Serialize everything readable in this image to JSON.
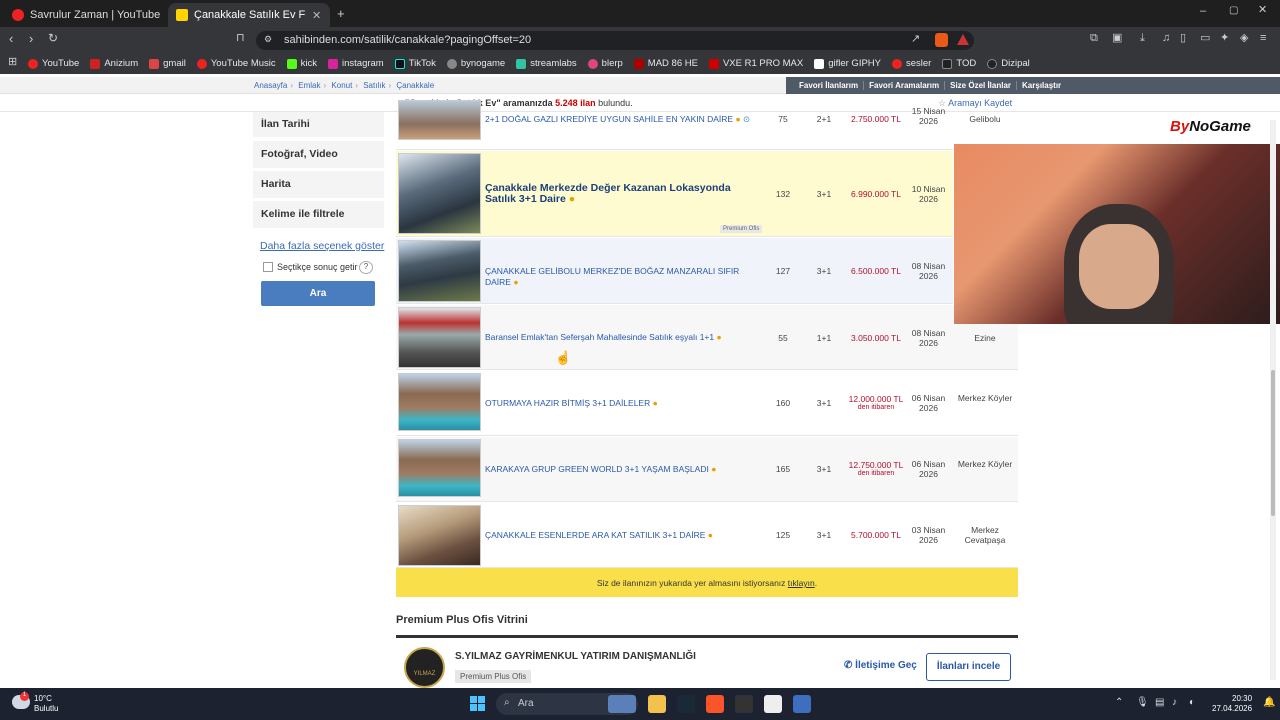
{
  "browser": {
    "tabs": [
      {
        "title": "Savrulur Zaman | YouTube Music"
      },
      {
        "title": "Çanakkale Satılık Ev Fiyatları sahi"
      }
    ],
    "url": "sahibinden.com/satilik/canakkale?pagingOffset=20",
    "bookmarks": [
      "YouTube",
      "Anizium",
      "gmail",
      "YouTube Music",
      "kick",
      "instagram",
      "TikTok",
      "bynogame",
      "streamlabs",
      "blerp",
      "MAD 86 HE",
      "VXE R1 PRO MAX",
      "gifler GIPHY",
      "sesler",
      "TOD",
      "Dizipal"
    ]
  },
  "site": {
    "breadcrumbs": [
      "Anasayfa",
      "Emlak",
      "Konut",
      "Satılık",
      "Çanakkale"
    ],
    "top_links": [
      "Favori İlanlarım",
      "Favori Aramalarım",
      "Size Özel İlanlar",
      "Karşılaştır"
    ],
    "result": {
      "prefix": "\"Çanakkale Satılık Ev\" aramanızda ",
      "count": "5.248 ilan",
      "suffix": " bulundu."
    },
    "save_search": "Aramayı Kaydet"
  },
  "sidebar": {
    "items": [
      "İlan Tarihi",
      "Fotoğraf, Video",
      "Harita",
      "Kelime ile filtrele"
    ],
    "more_link": "Daha fazla seçenek göster",
    "checkbox_label": "Seçtikçe sonuç getir",
    "help": "?",
    "search_button": "Ara"
  },
  "listings": [
    {
      "title": "2+1 DOĞAL GAZLI KREDİYE UYGUN SAHİLE EN YAKIN DAİRE",
      "m2": "75",
      "rooms": "2+1",
      "price": "2.750.000 TL",
      "price_sub": "",
      "date": "15 Nisan 2026",
      "location": "Gelibolu"
    },
    {
      "title": "Çanakkale Merkezde Değer Kazanan Lokasyonda Satılık 3+1 Daire",
      "m2": "132",
      "rooms": "3+1",
      "price": "6.990.000 TL",
      "price_sub": "",
      "date": "10 Nisan 2026",
      "location": "",
      "tag": "Premium Ofis"
    },
    {
      "title": "ÇANAKKALE GELİBOLU MERKEZ'DE BOĞAZ MANZARALI SIFIR DAİRE",
      "m2": "127",
      "rooms": "3+1",
      "price": "6.500.000 TL",
      "price_sub": "",
      "date": "08 Nisan 2026",
      "location": ""
    },
    {
      "title": "Baransel Emlak'tan Seferşah Mahallesinde Satılık eşyalı 1+1",
      "m2": "55",
      "rooms": "1+1",
      "price": "3.050.000 TL",
      "price_sub": "",
      "date": "08 Nisan 2026",
      "location": "Ezine"
    },
    {
      "title": "OTURMAYA HAZIR BİTMİŞ 3+1 DAİLELER",
      "m2": "160",
      "rooms": "3+1",
      "price": "12.000.000 TL",
      "price_sub": "den itibaren",
      "date": "06 Nisan 2026",
      "location": "Merkez Köyler"
    },
    {
      "title": "KARAKAYA GRUP GREEN WORLD 3+1 YAŞAM BAŞLADI",
      "m2": "165",
      "rooms": "3+1",
      "price": "12.750.000 TL",
      "price_sub": "den itibaren",
      "date": "06 Nisan 2026",
      "location": "Merkez Köyler"
    },
    {
      "title": "ÇANAKKALE ESENLERDE ARA KAT SATILIK 3+1 DAİRE",
      "m2": "125",
      "rooms": "3+1",
      "price": "5.700.000 TL",
      "price_sub": "",
      "date": "03 Nisan 2026",
      "location": "Merkez Cevatpaşa"
    }
  ],
  "promo": {
    "text": "Siz de ilanınızın yukarıda yer almasını istiyorsanız ",
    "link": "tıklayın",
    "end": "."
  },
  "premium": {
    "heading": "Premium Plus Ofis Vitrini",
    "office": "S.YILMAZ GAYRİMENKUL YATIRIM DANIŞMANLIĞI",
    "badge": "Premium Plus Ofis",
    "logo_text": "YILMAZ",
    "contact": "İletişime Geç",
    "listings_button": "İlanları incele"
  },
  "overlay": {
    "brand_a": "By",
    "brand_b": "NoGame"
  },
  "taskbar": {
    "temp": "10°C",
    "condition": "Bulutlu",
    "search": "Ara",
    "time": "20:30",
    "date": "27.04.2026"
  },
  "colors": {
    "link": "#2a59a8",
    "price": "#b2102c",
    "highlight": "#fefbd0",
    "promo": "#f9e04a"
  }
}
